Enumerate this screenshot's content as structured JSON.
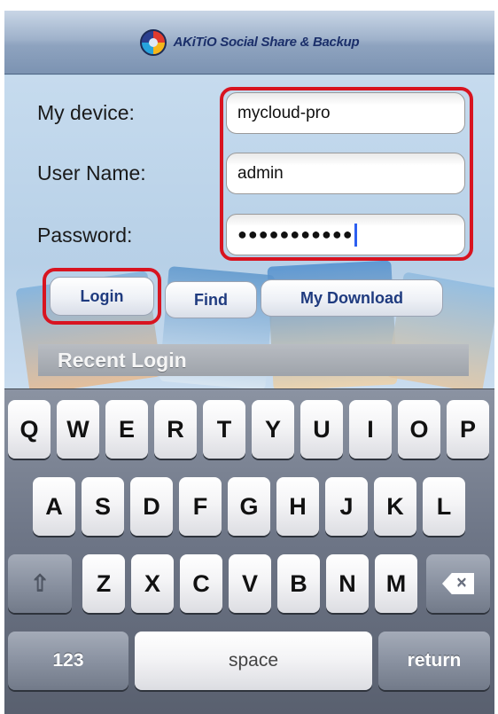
{
  "header": {
    "app_title": "AKiTiO Social Share & Backup",
    "logo_icon": "akitio-logo-icon"
  },
  "form": {
    "device_label": "My device:",
    "device_value": "mycloud-pro",
    "username_label": "User Name:",
    "username_value": "admin",
    "password_label": "Password:",
    "password_masked": "●●●●●●●●●●●"
  },
  "buttons": {
    "login": "Login",
    "find": "Find",
    "my_download": "My Download"
  },
  "recent": {
    "title": "Recent Login"
  },
  "keyboard": {
    "row1": [
      "Q",
      "W",
      "E",
      "R",
      "T",
      "Y",
      "U",
      "I",
      "O",
      "P"
    ],
    "row2": [
      "A",
      "S",
      "D",
      "F",
      "G",
      "H",
      "J",
      "K",
      "L"
    ],
    "row3": [
      "Z",
      "X",
      "C",
      "V",
      "B",
      "N",
      "M"
    ],
    "shift_icon": "shift-arrow-icon",
    "backspace_icon": "backspace-icon",
    "numbers_label": "123",
    "space_label": "space",
    "return_label": "return"
  },
  "colors": {
    "highlight": "#d81420",
    "button_text": "#1f3b7f",
    "caret": "#2c5ff0"
  }
}
